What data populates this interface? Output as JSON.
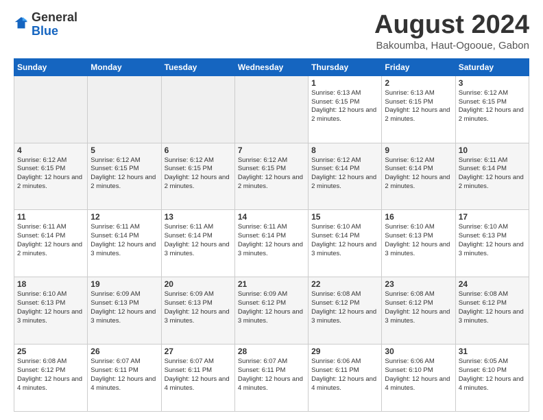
{
  "logo": {
    "general": "General",
    "blue": "Blue"
  },
  "title": "August 2024",
  "subtitle": "Bakoumba, Haut-Ogooue, Gabon",
  "days_of_week": [
    "Sunday",
    "Monday",
    "Tuesday",
    "Wednesday",
    "Thursday",
    "Friday",
    "Saturday"
  ],
  "weeks": [
    [
      {
        "day": "",
        "info": ""
      },
      {
        "day": "",
        "info": ""
      },
      {
        "day": "",
        "info": ""
      },
      {
        "day": "",
        "info": ""
      },
      {
        "day": "1",
        "info": "Sunrise: 6:13 AM\nSunset: 6:15 PM\nDaylight: 12 hours and 2 minutes."
      },
      {
        "day": "2",
        "info": "Sunrise: 6:13 AM\nSunset: 6:15 PM\nDaylight: 12 hours and 2 minutes."
      },
      {
        "day": "3",
        "info": "Sunrise: 6:12 AM\nSunset: 6:15 PM\nDaylight: 12 hours and 2 minutes."
      }
    ],
    [
      {
        "day": "4",
        "info": "Sunrise: 6:12 AM\nSunset: 6:15 PM\nDaylight: 12 hours and 2 minutes."
      },
      {
        "day": "5",
        "info": "Sunrise: 6:12 AM\nSunset: 6:15 PM\nDaylight: 12 hours and 2 minutes."
      },
      {
        "day": "6",
        "info": "Sunrise: 6:12 AM\nSunset: 6:15 PM\nDaylight: 12 hours and 2 minutes."
      },
      {
        "day": "7",
        "info": "Sunrise: 6:12 AM\nSunset: 6:15 PM\nDaylight: 12 hours and 2 minutes."
      },
      {
        "day": "8",
        "info": "Sunrise: 6:12 AM\nSunset: 6:14 PM\nDaylight: 12 hours and 2 minutes."
      },
      {
        "day": "9",
        "info": "Sunrise: 6:12 AM\nSunset: 6:14 PM\nDaylight: 12 hours and 2 minutes."
      },
      {
        "day": "10",
        "info": "Sunrise: 6:11 AM\nSunset: 6:14 PM\nDaylight: 12 hours and 2 minutes."
      }
    ],
    [
      {
        "day": "11",
        "info": "Sunrise: 6:11 AM\nSunset: 6:14 PM\nDaylight: 12 hours and 2 minutes."
      },
      {
        "day": "12",
        "info": "Sunrise: 6:11 AM\nSunset: 6:14 PM\nDaylight: 12 hours and 3 minutes."
      },
      {
        "day": "13",
        "info": "Sunrise: 6:11 AM\nSunset: 6:14 PM\nDaylight: 12 hours and 3 minutes."
      },
      {
        "day": "14",
        "info": "Sunrise: 6:11 AM\nSunset: 6:14 PM\nDaylight: 12 hours and 3 minutes."
      },
      {
        "day": "15",
        "info": "Sunrise: 6:10 AM\nSunset: 6:14 PM\nDaylight: 12 hours and 3 minutes."
      },
      {
        "day": "16",
        "info": "Sunrise: 6:10 AM\nSunset: 6:13 PM\nDaylight: 12 hours and 3 minutes."
      },
      {
        "day": "17",
        "info": "Sunrise: 6:10 AM\nSunset: 6:13 PM\nDaylight: 12 hours and 3 minutes."
      }
    ],
    [
      {
        "day": "18",
        "info": "Sunrise: 6:10 AM\nSunset: 6:13 PM\nDaylight: 12 hours and 3 minutes."
      },
      {
        "day": "19",
        "info": "Sunrise: 6:09 AM\nSunset: 6:13 PM\nDaylight: 12 hours and 3 minutes."
      },
      {
        "day": "20",
        "info": "Sunrise: 6:09 AM\nSunset: 6:13 PM\nDaylight: 12 hours and 3 minutes."
      },
      {
        "day": "21",
        "info": "Sunrise: 6:09 AM\nSunset: 6:12 PM\nDaylight: 12 hours and 3 minutes."
      },
      {
        "day": "22",
        "info": "Sunrise: 6:08 AM\nSunset: 6:12 PM\nDaylight: 12 hours and 3 minutes."
      },
      {
        "day": "23",
        "info": "Sunrise: 6:08 AM\nSunset: 6:12 PM\nDaylight: 12 hours and 3 minutes."
      },
      {
        "day": "24",
        "info": "Sunrise: 6:08 AM\nSunset: 6:12 PM\nDaylight: 12 hours and 3 minutes."
      }
    ],
    [
      {
        "day": "25",
        "info": "Sunrise: 6:08 AM\nSunset: 6:12 PM\nDaylight: 12 hours and 4 minutes."
      },
      {
        "day": "26",
        "info": "Sunrise: 6:07 AM\nSunset: 6:11 PM\nDaylight: 12 hours and 4 minutes."
      },
      {
        "day": "27",
        "info": "Sunrise: 6:07 AM\nSunset: 6:11 PM\nDaylight: 12 hours and 4 minutes."
      },
      {
        "day": "28",
        "info": "Sunrise: 6:07 AM\nSunset: 6:11 PM\nDaylight: 12 hours and 4 minutes."
      },
      {
        "day": "29",
        "info": "Sunrise: 6:06 AM\nSunset: 6:11 PM\nDaylight: 12 hours and 4 minutes."
      },
      {
        "day": "30",
        "info": "Sunrise: 6:06 AM\nSunset: 6:10 PM\nDaylight: 12 hours and 4 minutes."
      },
      {
        "day": "31",
        "info": "Sunrise: 6:05 AM\nSunset: 6:10 PM\nDaylight: 12 hours and 4 minutes."
      }
    ]
  ]
}
